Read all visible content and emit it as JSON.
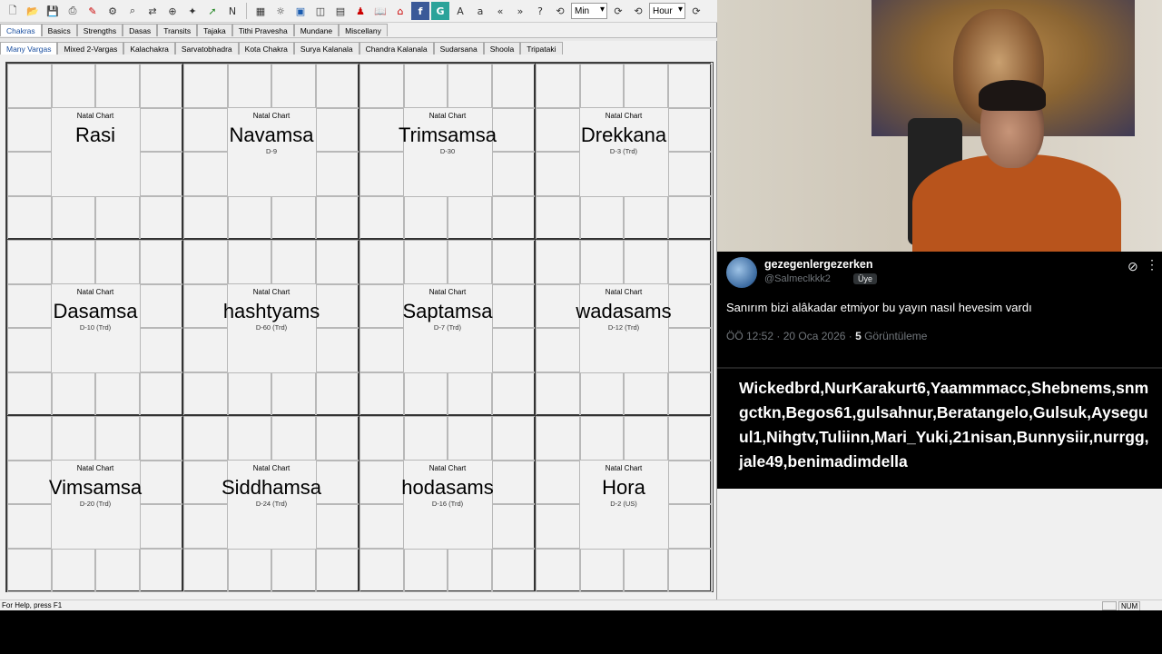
{
  "toolbar": {
    "select_min": "Min",
    "select_hour": "Hour"
  },
  "tabs_row1": [
    "Chakras",
    "Basics",
    "Strengths",
    "Dasas",
    "Transits",
    "Tajaka",
    "Tithi Pravesha",
    "Mundane",
    "Miscellany"
  ],
  "tabs_row2": [
    "Many Vargas",
    "Mixed 2-Vargas",
    "Kalachakra",
    "Sarvatobhadra",
    "Kota Chakra",
    "Surya Kalanala",
    "Chandra Kalanala",
    "Sudarsana",
    "Shoola",
    "Tripataki"
  ],
  "charts": [
    {
      "title": "Natal Chart",
      "name": "Rasi",
      "sub": ""
    },
    {
      "title": "Natal Chart",
      "name": "Navamsa",
      "sub": "D-9"
    },
    {
      "title": "Natal Chart",
      "name": "Trimsamsa",
      "sub": "D-30"
    },
    {
      "title": "Natal Chart",
      "name": "Drekkana",
      "sub": "D-3 (Trd)"
    },
    {
      "title": "Natal Chart",
      "name": "Dasamsa",
      "sub": "D-10 (Trd)"
    },
    {
      "title": "Natal Chart",
      "name": "hashtyams",
      "sub": "D-60 (Trd)"
    },
    {
      "title": "Natal Chart",
      "name": "Saptamsa",
      "sub": "D-7 (Trd)"
    },
    {
      "title": "Natal Chart",
      "name": "wadasams",
      "sub": "D-12 (Trd)"
    },
    {
      "title": "Natal Chart",
      "name": "Vimsamsa",
      "sub": "D-20 (Trd)"
    },
    {
      "title": "Natal Chart",
      "name": "Siddhamsa",
      "sub": "D-24 (Trd)"
    },
    {
      "title": "Natal Chart",
      "name": "hodasams",
      "sub": "D-16 (Trd)"
    },
    {
      "title": "Natal Chart",
      "name": "Hora",
      "sub": "D-2 (US)"
    }
  ],
  "status": {
    "help": "For Help, press F1",
    "num": "NUM"
  },
  "tweet": {
    "name": "gezegenlergezerken",
    "handle": "@Salmeclkkk2",
    "badge": "Üye",
    "text": "Sanırım bizi alâkadar etmiyor bu yayın nasıl hevesim vardı",
    "time": "ÖÖ 12:52 · 20 Oca 2026 · ",
    "views_count": "5",
    "views_label": " Görüntüleme"
  },
  "subscribers": {
    "text": "Wickedbrd,NurKarakurt6,Yaammmacc,Shebnems,snmgctkn,Begos61,gulsahnur,Beratangelo,Gulsuk,Ayseguul1,Nihgtv,Tuliinn,Mari_Yuki,21nisan,Bunnysiir,nurrgg,jale49,benimadimdella"
  },
  "colors": {
    "planet": "#a32232",
    "ascendant": "#8a1fa0",
    "twitter_bg": "#000000"
  }
}
